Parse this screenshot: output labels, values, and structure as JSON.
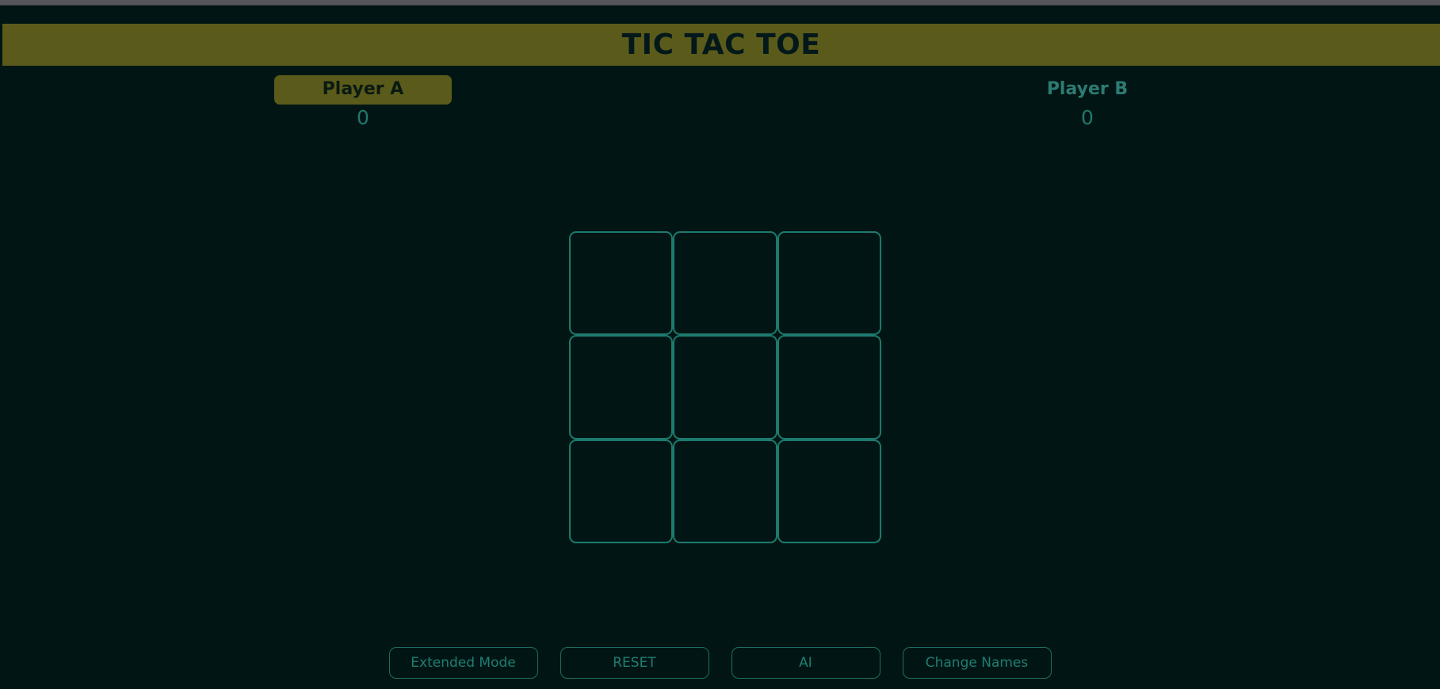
{
  "window": {
    "chrome_color": "#55555b"
  },
  "theme": {
    "background": "#011614",
    "accent_olive": "#5a5a1b",
    "accent_teal": "#1d7a6e",
    "text_teal": "#2d7b72",
    "title_text": "#03181a"
  },
  "header": {
    "title": "TIC TAC TOE"
  },
  "scoreboard": {
    "players": [
      {
        "name": "Player A",
        "score": "0",
        "active": true
      },
      {
        "name": "Player B",
        "score": "0",
        "active": false
      }
    ]
  },
  "board": {
    "rows": 3,
    "columns": 3,
    "cells": [
      "",
      "",
      "",
      "",
      "",
      "",
      "",
      "",
      ""
    ]
  },
  "controls": {
    "buttons": [
      {
        "label": "Extended Mode"
      },
      {
        "label": "RESET"
      },
      {
        "label": "AI"
      },
      {
        "label": "Change Names"
      }
    ]
  }
}
